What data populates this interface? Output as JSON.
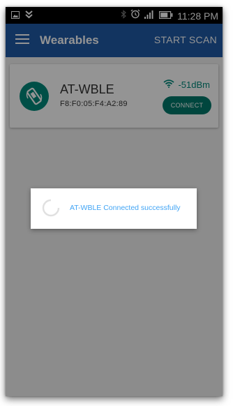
{
  "status_bar": {
    "time": "11:28 PM"
  },
  "app_bar": {
    "title": "Wearables",
    "action_label": "START SCAN"
  },
  "device": {
    "name": "AT-WBLE",
    "mac": "F8:F0:05:F4:A2:89",
    "rssi": "-51dBm",
    "connect_label": "CONNECT"
  },
  "dialog": {
    "message": "AT-WBLE Connected successfully"
  },
  "colors": {
    "app_bar": "#1f5aa6",
    "accent": "#00897b",
    "dialog_text": "#42a5f5"
  }
}
